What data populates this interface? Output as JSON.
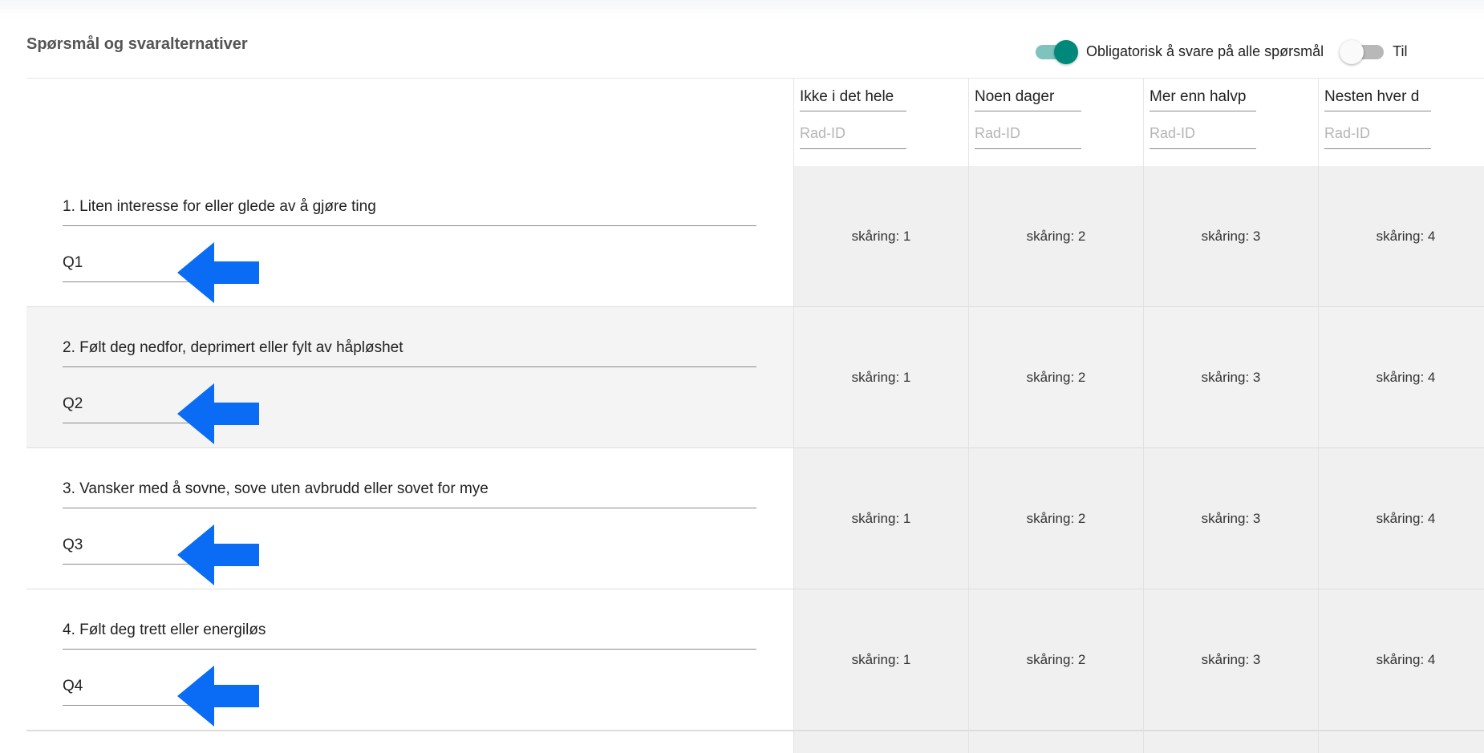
{
  "section": {
    "title": "Spørsmål og svaralternativer"
  },
  "toggles": [
    {
      "label": "Obligatorisk å svare på alle spørsmål",
      "on": true
    },
    {
      "label": "Til",
      "on": false
    }
  ],
  "colors": {
    "toggle_on": "#00897b",
    "toggle_on_track": "#7ec3bd",
    "arrow": "#0a6cf5",
    "cell_background": "#f0f0f0"
  },
  "columns": [
    {
      "title": "Ikke i det hele",
      "id_placeholder": "Rad-ID"
    },
    {
      "title": "Noen dager",
      "id_placeholder": "Rad-ID"
    },
    {
      "title": "Mer enn halvp",
      "id_placeholder": "Rad-ID"
    },
    {
      "title": "Nesten hver d",
      "id_placeholder": "Rad-ID"
    }
  ],
  "questions": [
    {
      "text": "1. Liten interesse for eller glede av å gjøre ting",
      "id": "Q1",
      "scores": [
        "skåring: 1",
        "skåring: 2",
        "skåring: 3",
        "skåring: 4"
      ]
    },
    {
      "text": "2. Følt deg nedfor, deprimert eller fylt av håpløshet",
      "id": "Q2",
      "scores": [
        "skåring: 1",
        "skåring: 2",
        "skåring: 3",
        "skåring: 4"
      ]
    },
    {
      "text": "3. Vansker med å sovne, sove uten avbrudd eller sovet for mye",
      "id": "Q3",
      "scores": [
        "skåring: 1",
        "skåring: 2",
        "skåring: 3",
        "skåring: 4"
      ]
    },
    {
      "text": "4. Følt deg trett eller energiløs",
      "id": "Q4",
      "scores": [
        "skåring: 1",
        "skåring: 2",
        "skåring: 3",
        "skåring: 4"
      ]
    }
  ],
  "annotations": {
    "arrow_icon": "arrow-left-icon"
  }
}
